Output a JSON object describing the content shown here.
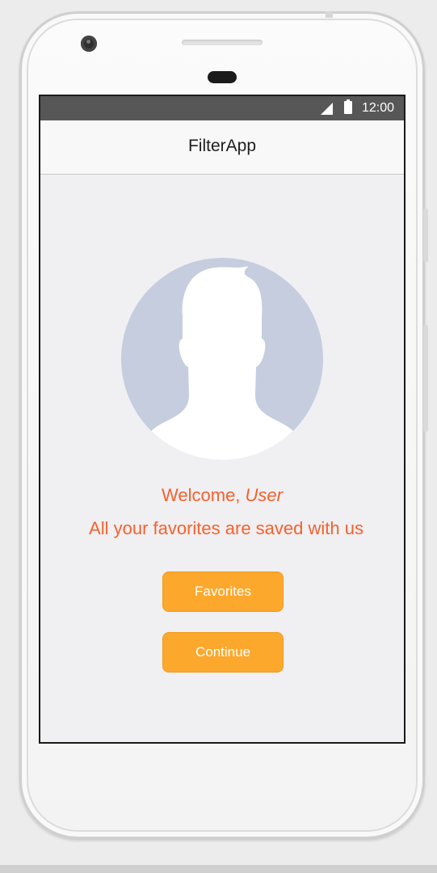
{
  "status_bar": {
    "time": "12:00",
    "signal_icon": "signal-icon",
    "battery_icon": "battery-icon"
  },
  "app_bar": {
    "title": "FilterApp"
  },
  "profile": {
    "avatar_icon": "person-silhouette-icon",
    "welcome_prefix": "Welcome, ",
    "user_name": "User",
    "tagline": "All your favorites are saved with us"
  },
  "actions": {
    "favorites_label": "Favorites",
    "continue_label": "Continue"
  },
  "colors": {
    "accent_text": "#f4622c",
    "button_fill": "#fca82d",
    "avatar_bg": "#c5cddf",
    "status_bar": "#575757"
  }
}
